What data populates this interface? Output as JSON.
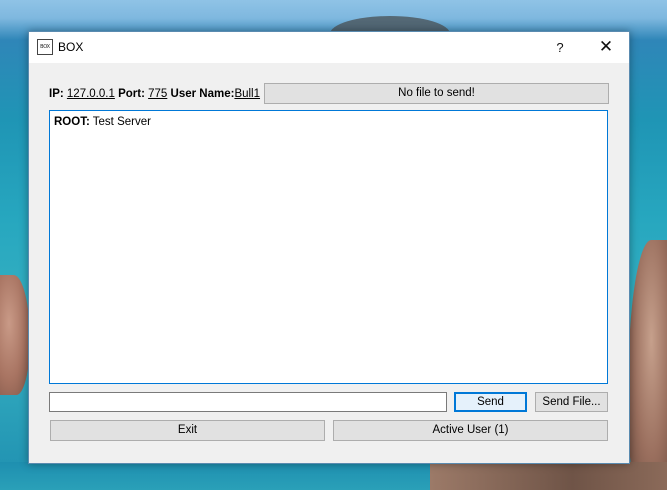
{
  "window": {
    "title": "BOX",
    "icon_text": "BOX",
    "help_label": "?",
    "close_label": "✕"
  },
  "info": {
    "ip_label": "IP:",
    "ip_value": "127.0.0.1",
    "port_label": "Port:",
    "port_value": "775",
    "user_label": "User Name:",
    "user_value": "Bull1"
  },
  "file_status_label": "No file to send!",
  "chat": {
    "messages": [
      {
        "sender": "ROOT:",
        "text": "Test Server"
      }
    ]
  },
  "message_input": {
    "value": ""
  },
  "buttons": {
    "send": "Send",
    "send_file": "Send File...",
    "exit": "Exit",
    "active_user": "Active User (1)"
  },
  "colors": {
    "accent": "#0078d7",
    "window_bg": "#f0f0f0",
    "button_bg": "#e1e1e1"
  }
}
